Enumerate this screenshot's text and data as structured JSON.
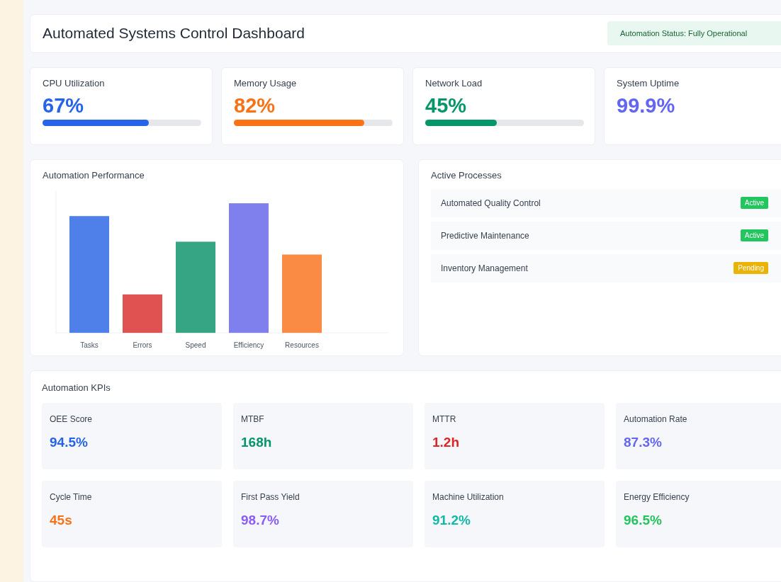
{
  "header": {
    "title": "Automated Systems Control Dashboard",
    "status": "Automation Status: Fully Operational"
  },
  "metrics": [
    {
      "label": "CPU Utilization",
      "value": "67%",
      "color": "#2563eb",
      "level": 0.67
    },
    {
      "label": "Memory Usage",
      "value": "82%",
      "color": "#f97316",
      "level": 0.82
    },
    {
      "label": "Network Load",
      "value": "45%",
      "color": "#059669",
      "level": 0.45
    },
    {
      "label": "System Uptime",
      "value": "99.9%",
      "color": "#6366f1"
    }
  ],
  "performance": {
    "title": "Automation Performance",
    "bars": [
      {
        "label": "Tasks",
        "color": "#4f7fe8"
      },
      {
        "label": "Errors",
        "color": "#e05252"
      },
      {
        "label": "Speed",
        "color": "#36a583"
      },
      {
        "label": "Efficiency",
        "color": "#7f7fee"
      },
      {
        "label": "Resources",
        "color": "#f98b45"
      }
    ]
  },
  "processes": {
    "title": "Active Processes",
    "items": [
      {
        "name": "Automated Quality Control",
        "status": "Active",
        "kind": "active"
      },
      {
        "name": "Predictive Maintenance",
        "status": "Active",
        "kind": "active"
      },
      {
        "name": "Inventory Management",
        "status": "Pending",
        "kind": "pending"
      }
    ]
  },
  "kpis": {
    "title": "Automation KPIs",
    "items": [
      {
        "label": "OEE Score",
        "value": "94.5%",
        "color": "#2563eb"
      },
      {
        "label": "MTBF",
        "value": "168h",
        "color": "#059669"
      },
      {
        "label": "MTTR",
        "value": "1.2h",
        "color": "#dc2626"
      },
      {
        "label": "Automation Rate",
        "value": "87.3%",
        "color": "#6366f1"
      },
      {
        "label": "Cycle Time",
        "value": "45s",
        "color": "#f97316"
      },
      {
        "label": "First Pass Yield",
        "value": "98.7%",
        "color": "#8b5cf6"
      },
      {
        "label": "Machine Utilization",
        "value": "91.2%",
        "color": "#14b8a6"
      },
      {
        "label": "Energy Efficiency",
        "value": "96.5%",
        "color": "#22c55e"
      }
    ]
  }
}
